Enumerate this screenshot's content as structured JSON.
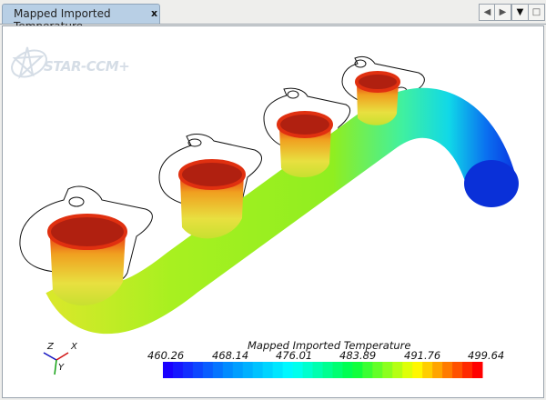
{
  "tab": {
    "title": "Mapped Imported Temperature",
    "close": "x"
  },
  "controls": {
    "prev": "◀",
    "next": "▶",
    "menu": "▼",
    "maximize": "□"
  },
  "logo": "STAR-CCM+",
  "colorbar": {
    "title": "Mapped Imported Temperature",
    "labels": [
      "460.26",
      "468.14",
      "476.01",
      "483.89",
      "491.76",
      "499.64"
    ],
    "min": 460.26,
    "max": 499.64,
    "segments": 32,
    "stops": [
      "#1a00ff",
      "#0090ff",
      "#00ffff",
      "#00ff40",
      "#ffff00",
      "#ff0000"
    ]
  },
  "triad": {
    "x": "X",
    "y": "Y",
    "z": "Z"
  }
}
